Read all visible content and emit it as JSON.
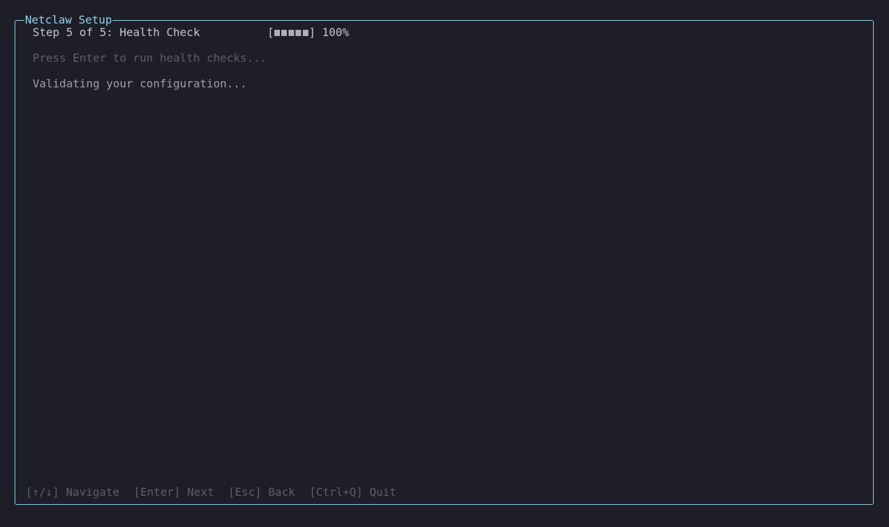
{
  "app": {
    "title": "Netclaw Setup"
  },
  "wizard": {
    "step_label": "Step 5 of 5: Health Check",
    "progress": {
      "bracket_open": "[",
      "bracket_close": "]",
      "segments_filled": 5,
      "segments_total": 5,
      "percent_text": "100%"
    },
    "prompt": "Press Enter to run health checks...",
    "status": "Validating your configuration..."
  },
  "footer": {
    "hints": [
      {
        "key": "[↑/↓]",
        "action": "Navigate"
      },
      {
        "key": "[Enter]",
        "action": "Next"
      },
      {
        "key": "[Esc]",
        "action": "Back"
      },
      {
        "key": "[Ctrl+Q]",
        "action": "Quit"
      }
    ]
  },
  "colors": {
    "background": "#1e1e28",
    "border": "#8fd3e8",
    "text": "#c8c8d0",
    "dim": "#5e5e66"
  }
}
